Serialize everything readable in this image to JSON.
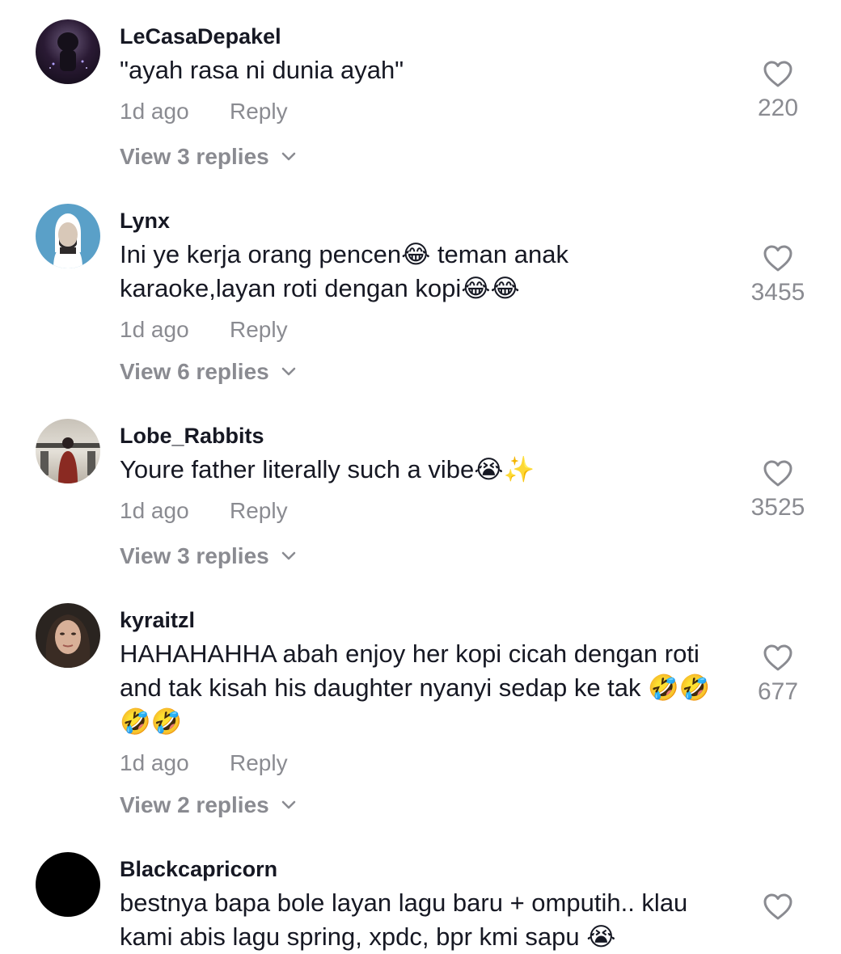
{
  "comments": [
    {
      "username": "LeCasaDepakel",
      "text": "\"ayah rasa ni dunia ayah\"",
      "time": "1d ago",
      "reply_label": "Reply",
      "view_replies": "View 3 replies",
      "likes": "220",
      "avatar_colors": [
        "#1a1024",
        "#4a2a5a"
      ]
    },
    {
      "username": "Lynx",
      "text": "Ini ye kerja orang pencen😂 teman anak karaoke,layan roti dengan kopi😂😂",
      "time": "1d ago",
      "reply_label": "Reply",
      "view_replies": "View 6 replies",
      "likes": "3455",
      "avatar_colors": [
        "#5aa0c8",
        "#2e2a2a"
      ]
    },
    {
      "username": "Lobe_Rabbits",
      "text": "Youre father literally such a vibe😭✨",
      "time": "1d ago",
      "reply_label": "Reply",
      "view_replies": "View 3 replies",
      "likes": "3525",
      "avatar_colors": [
        "#d8d2c8",
        "#8a2a22"
      ]
    },
    {
      "username": "kyraitzl",
      "text": "HAHAHAHHA abah enjoy her kopi cicah dengan roti and tak kisah his daughter nyanyi sedap ke tak 🤣🤣🤣🤣",
      "time": "1d ago",
      "reply_label": "Reply",
      "view_replies": "View 2 replies",
      "likes": "677",
      "avatar_colors": [
        "#2a2420",
        "#c8a088"
      ]
    },
    {
      "username": "Blackcapricorn",
      "text": "bestnya bapa bole layan lagu baru + omputih.. klau kami abis lagu spring, xpdc, bpr kmi sapu 😭",
      "time": "",
      "reply_label": "",
      "view_replies": "",
      "likes": "",
      "avatar_colors": [
        "#000000",
        "#000000"
      ]
    }
  ],
  "colors": {
    "text": "#161823",
    "muted": "#8a8b91",
    "heart": "#8a8b91"
  },
  "icons": {
    "like": "heart-outline-icon",
    "expand": "chevron-down-icon"
  }
}
